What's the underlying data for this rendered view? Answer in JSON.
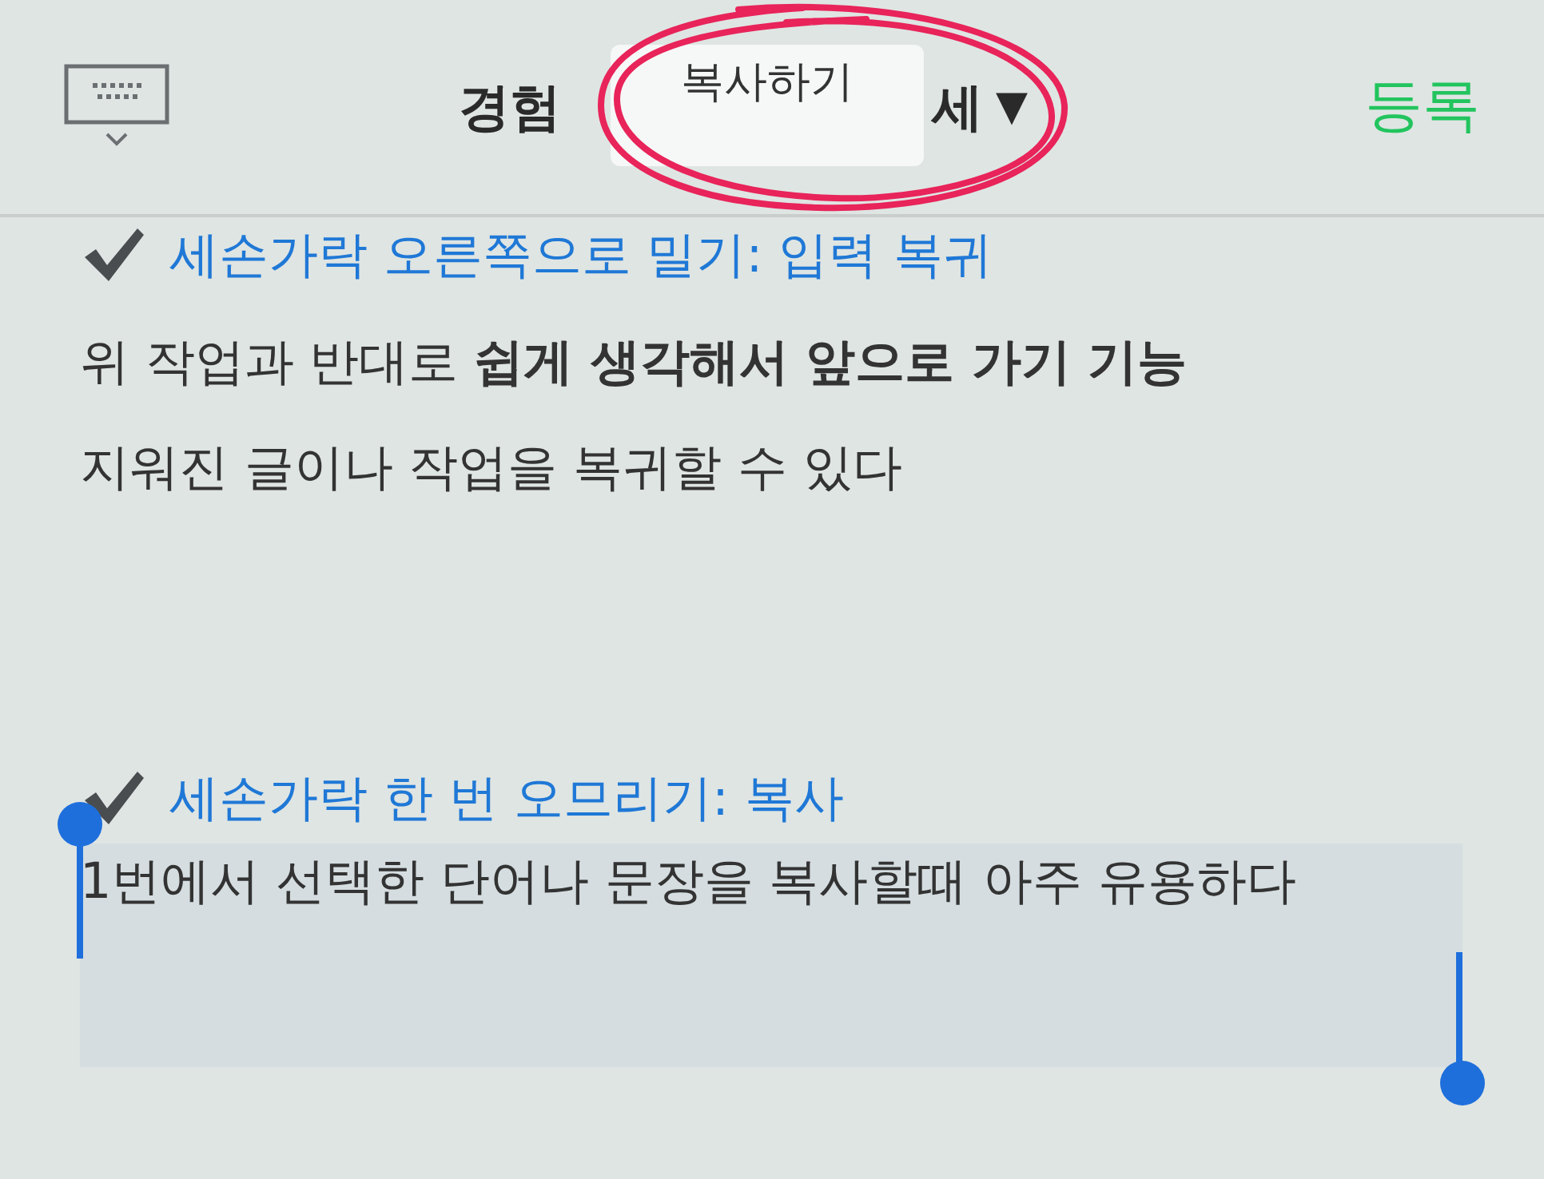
{
  "header": {
    "title_start": "경험",
    "title_end": "세",
    "title_caret": "▼",
    "action": "등록"
  },
  "popup": {
    "label": "복사하기"
  },
  "annotation": {
    "kind": "circle"
  },
  "sections": [
    {
      "heading": "세손가락 오른쪽으로 밀기: 입력 복귀",
      "lines": [
        "위 작업과 반대로 **쉽게 생각해서 앞으로 가기 기능**",
        "지워진 글이나 작업을 복귀할 수 있다"
      ],
      "selected": false
    },
    {
      "heading": "세손가락 한 번 오므리기: 복사",
      "lines": [
        "1번에서 선택한 단어나 문장을 복사할때 아주 유용하다"
      ],
      "selected": true
    }
  ]
}
